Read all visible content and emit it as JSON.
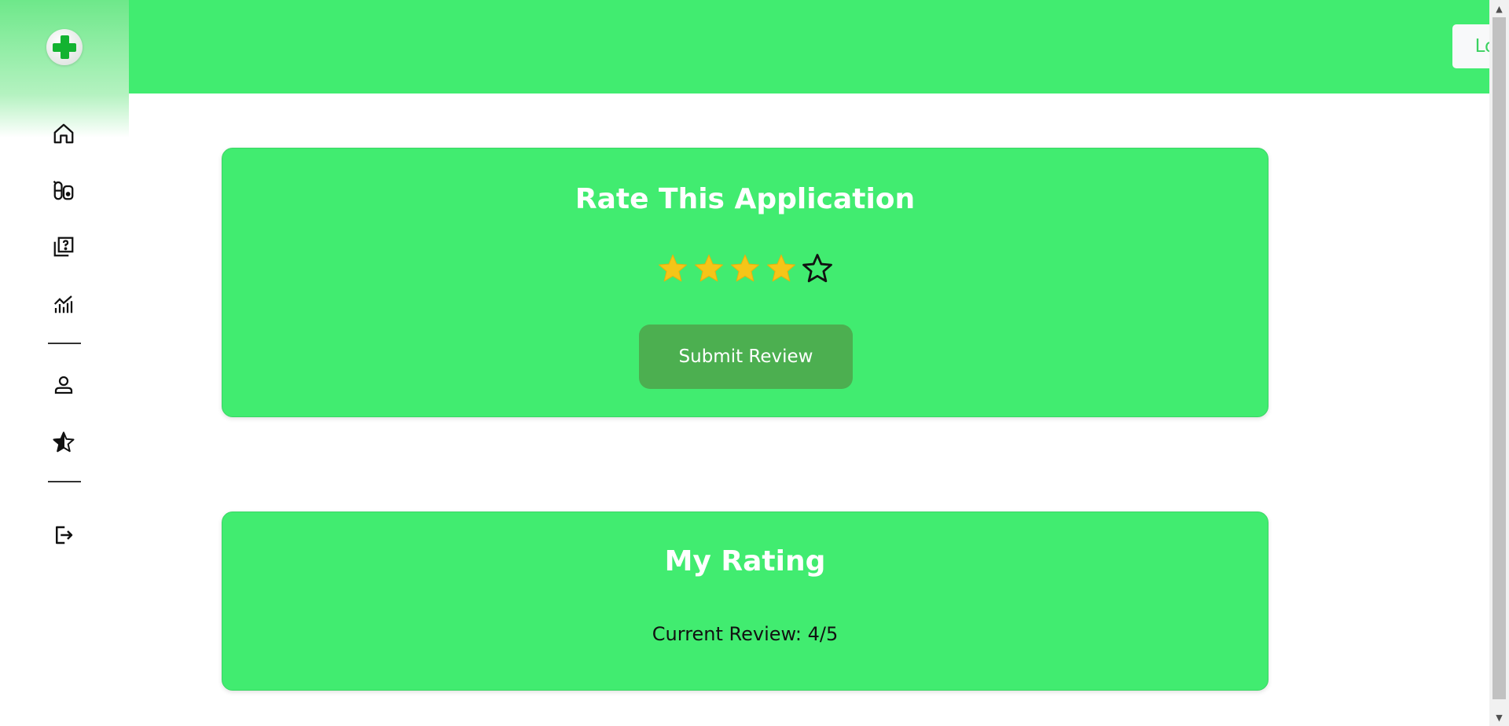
{
  "header": {
    "logout_label": "Logout"
  },
  "sidebar": {
    "items": [
      {
        "icon": "home-icon"
      },
      {
        "icon": "medicine-icon"
      },
      {
        "icon": "quiz-icon"
      },
      {
        "icon": "analytics-icon"
      },
      {
        "icon": "profile-icon"
      },
      {
        "icon": "rating-icon"
      },
      {
        "icon": "logout-icon"
      }
    ]
  },
  "rate_card": {
    "title": "Rate This Application",
    "rating": 4,
    "max_rating": 5,
    "submit_label": "Submit Review"
  },
  "my_rating_card": {
    "title": "My Rating",
    "current_review": "Current Review: 4/5"
  },
  "colors": {
    "accent": "#41ec70",
    "button_green": "#4caf50",
    "star_filled": "#f5c518",
    "logo_cross": "#13b331"
  }
}
